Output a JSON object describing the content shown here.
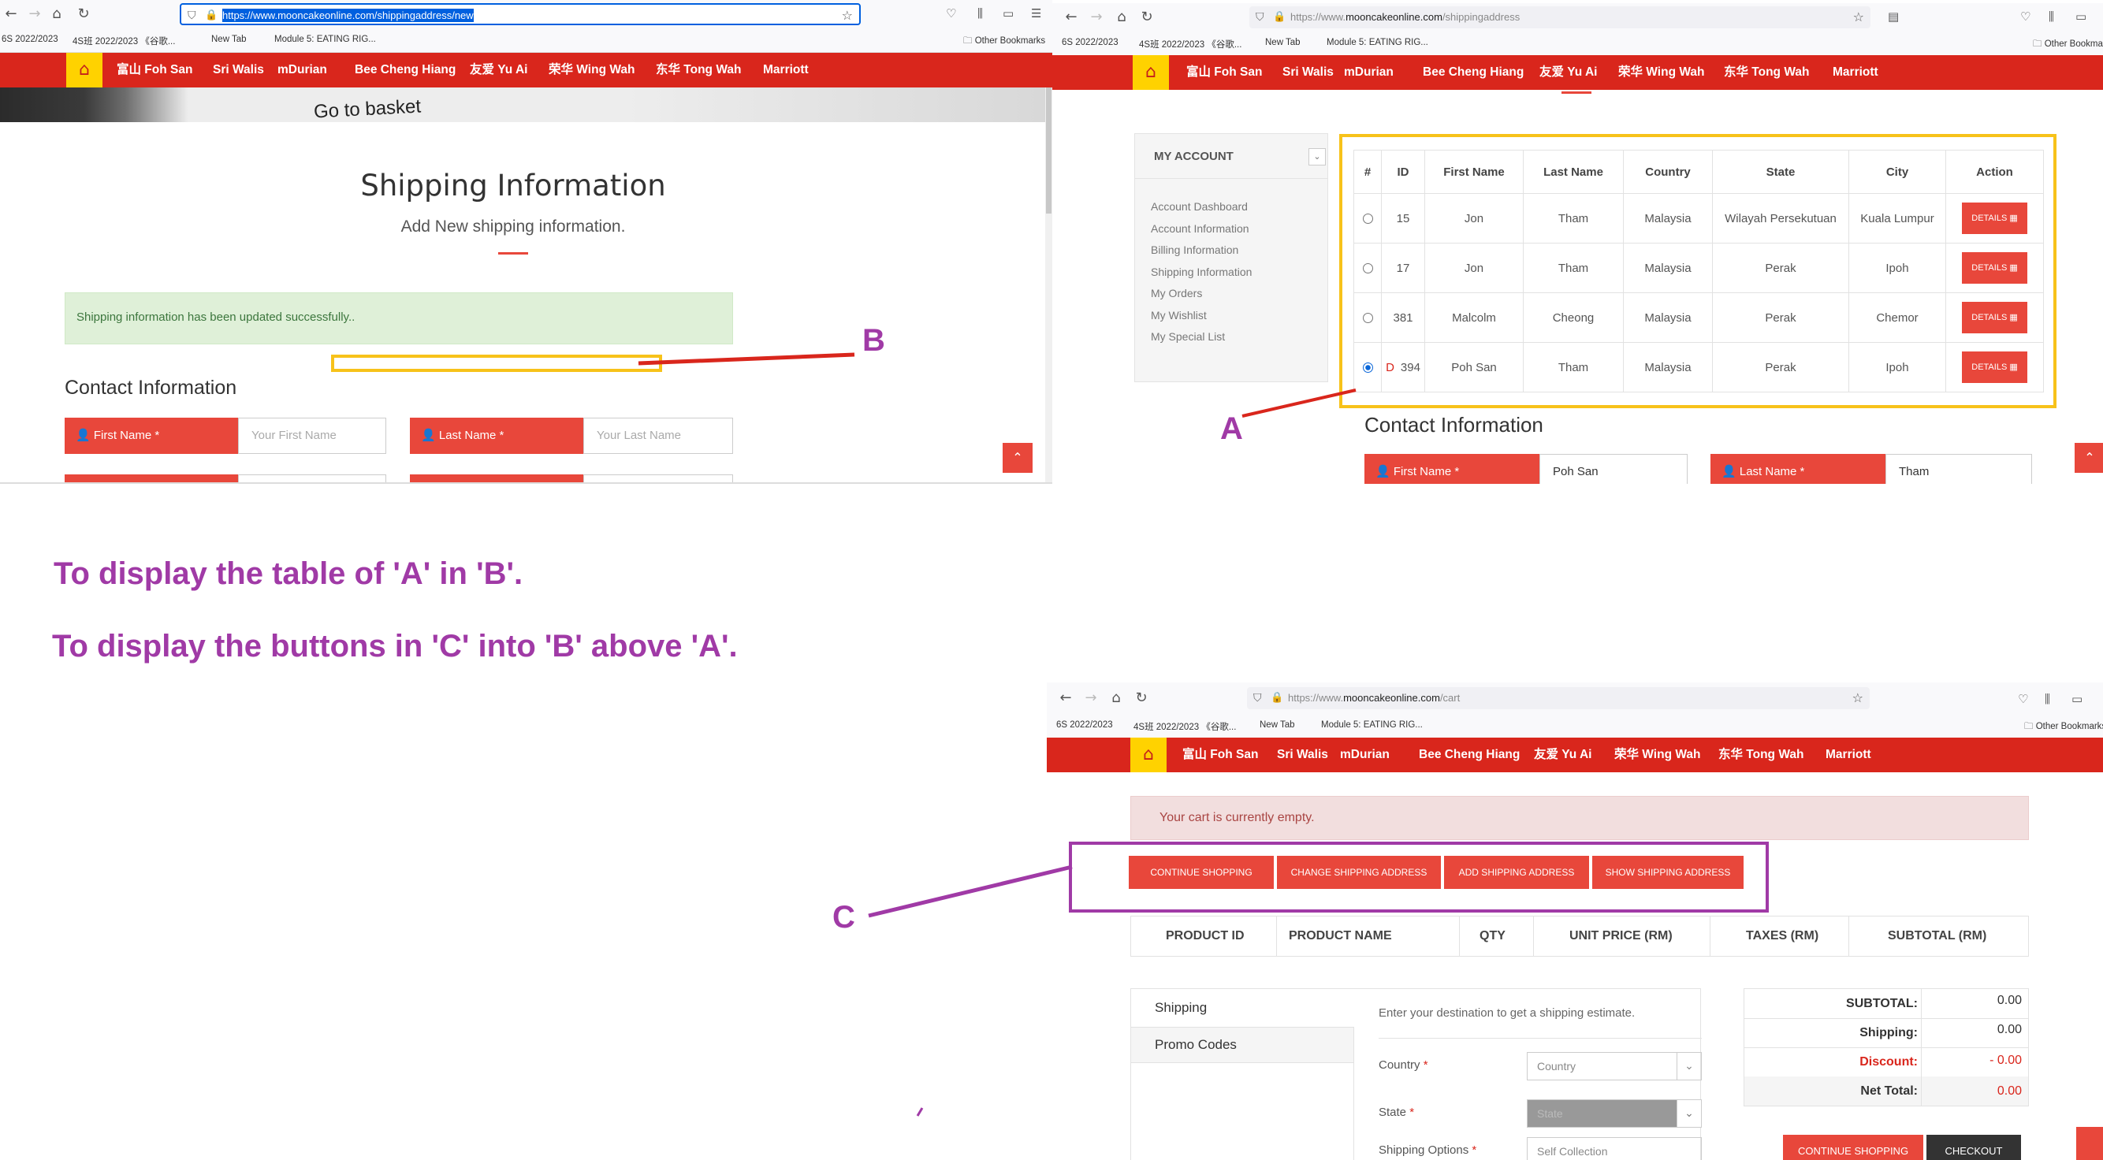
{
  "annotation": {
    "line1": "To display the table of 'A' in 'B'.",
    "line2": "To display the buttons in 'C' into 'B' above 'A'.",
    "label_a": "A",
    "label_b": "B",
    "label_c": "C",
    "color_purple": "#a03aa6",
    "color_yellow": "#f7c21a",
    "color_red_line": "#d9261c"
  },
  "common": {
    "bookmarks": [
      "6S 2022/2023",
      "4S班 2022/2023 《谷歌...",
      "New Tab",
      "Module 5: EATING RIG..."
    ],
    "other_bookmarks": "Other Bookmarks",
    "nav_items": [
      "富山 Foh San",
      "Sri Walis",
      "mDurian",
      "Bee Cheng Hiang",
      "友爱 Yu Ai",
      "荣华 Wing Wah",
      "东华 Tong Wah",
      "Marriott"
    ]
  },
  "panel_left": {
    "url": "https://www.mooncakeonline.com/shippingaddress/new",
    "banner_text": "Go to basket",
    "title": "Shipping Information",
    "subtitle": "Add New shipping information.",
    "success_msg": "Shipping information has been updated successfully..",
    "section_title": "Contact Information",
    "first_name_label": "First Name *",
    "first_name_placeholder": "Your First Name",
    "last_name_label": "Last Name *",
    "last_name_placeholder": "Your Last Name"
  },
  "panel_right": {
    "url_prefix": "https://www.",
    "url_domain": "mooncakeonline.com",
    "url_path": "/shippingaddress",
    "sidebar_title": "MY ACCOUNT",
    "sidebar_items": [
      "Account Dashboard",
      "Account Information",
      "Billing Information",
      "Shipping Information",
      "My Orders",
      "My Wishlist",
      "My Special List"
    ],
    "table_headers": [
      "#",
      "ID",
      "First Name",
      "Last Name",
      "Country",
      "State",
      "City",
      "Action"
    ],
    "table_rows": [
      {
        "selected": false,
        "flag": "",
        "id": "15",
        "first": "Jon",
        "last": "Tham",
        "country": "Malaysia",
        "state": "Wilayah Persekutuan",
        "city": "Kuala Lumpur",
        "action": "DETAILS"
      },
      {
        "selected": false,
        "flag": "",
        "id": "17",
        "first": "Jon",
        "last": "Tham",
        "country": "Malaysia",
        "state": "Perak",
        "city": "Ipoh",
        "action": "DETAILS"
      },
      {
        "selected": false,
        "flag": "",
        "id": "381",
        "first": "Malcolm",
        "last": "Cheong",
        "country": "Malaysia",
        "state": "Perak",
        "city": "Chemor",
        "action": "DETAILS"
      },
      {
        "selected": true,
        "flag": "D",
        "id": "394",
        "first": "Poh San",
        "last": "Tham",
        "country": "Malaysia",
        "state": "Perak",
        "city": "Ipoh",
        "action": "DETAILS"
      }
    ],
    "section_title": "Contact Information",
    "first_name_label": "First Name *",
    "first_name_value": "Poh San",
    "last_name_label": "Last Name *",
    "last_name_value": "Tham"
  },
  "panel_bottom": {
    "url_prefix": "https://www.",
    "url_domain": "mooncakeonline.com",
    "url_path": "/cart",
    "cart_msg": "Your cart is currently empty.",
    "buttons": [
      "CONTINUE SHOPPING",
      "CHANGE SHIPPING ADDRESS",
      "ADD SHIPPING ADDRESS",
      "SHOW SHIPPING ADDRESS"
    ],
    "cart_headers": [
      "PRODUCT ID",
      "PRODUCT NAME",
      "QTY",
      "UNIT PRICE (RM)",
      "TAXES (RM)",
      "SUBTOTAL (RM)"
    ],
    "tabs": [
      "Shipping",
      "Promo Codes"
    ],
    "estimate_text": "Enter your destination to get a shipping estimate.",
    "country_label": "Country",
    "country_placeholder": "Country",
    "state_label": "State",
    "state_placeholder": "State",
    "shipping_options_label": "Shipping Options",
    "shipping_options_value": "Self Collection",
    "summary": [
      {
        "label": "SUBTOTAL:",
        "value": "0.00"
      },
      {
        "label": "Shipping:",
        "value": "0.00"
      },
      {
        "label": "Discount:",
        "value": "- 0.00"
      },
      {
        "label": "Net Total:",
        "value": "0.00"
      }
    ],
    "continue_btn": "CONTINUE SHOPPING",
    "checkout_btn": "CHECKOUT"
  }
}
